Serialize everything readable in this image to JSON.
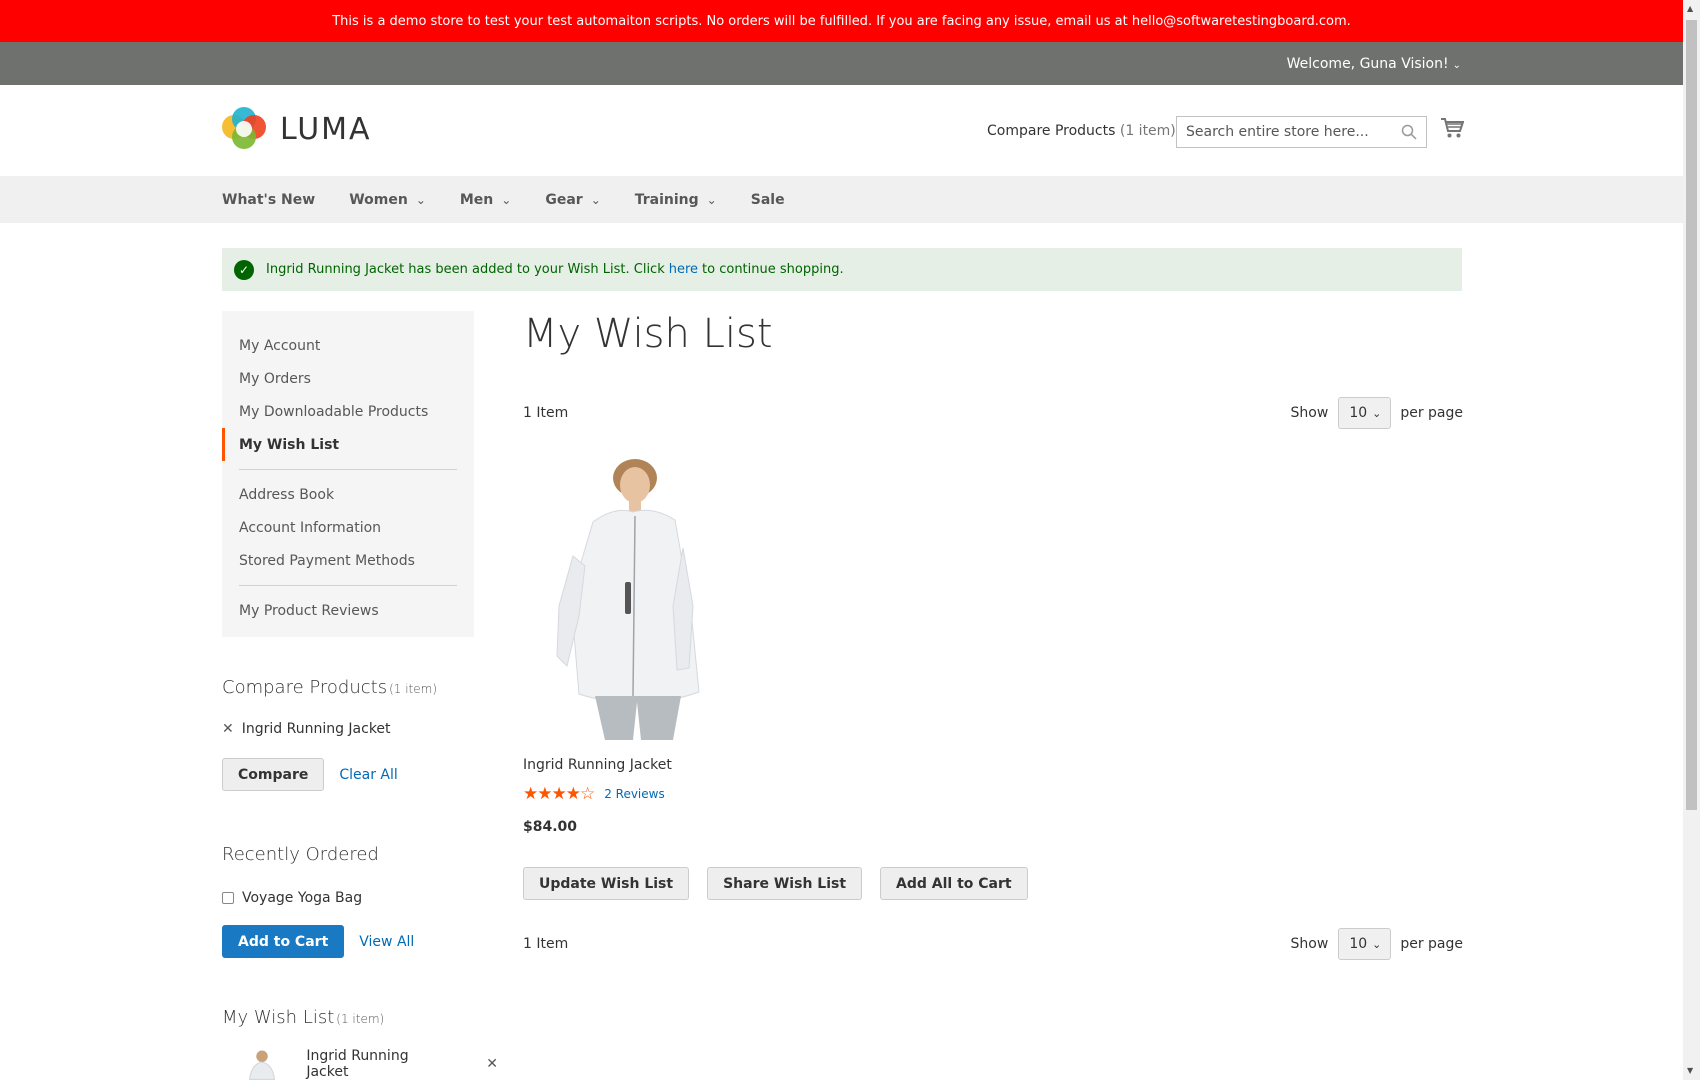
{
  "demo_notice": "This is a demo store to test your test automaiton scripts. No orders will be fulfilled. If you are facing any issue, email us at hello@softwaretestingboard.com.",
  "header": {
    "welcome": "Welcome, Guna Vision!",
    "logo_text": "LUMA",
    "compare_label": "Compare Products",
    "compare_count": "(1 item)",
    "search_placeholder": "Search entire store here...",
    "icons": {
      "search": "search-icon",
      "cart": "cart-icon"
    }
  },
  "nav": {
    "items": [
      {
        "label": "What's New"
      },
      {
        "label": "Women"
      },
      {
        "label": "Men"
      },
      {
        "label": "Gear"
      },
      {
        "label": "Training"
      },
      {
        "label": "Sale"
      }
    ]
  },
  "message": {
    "before": "Ingrid Running Jacket has been added to your Wish List. Click",
    "link": "here",
    "after": "to continue shopping."
  },
  "sidebar": {
    "items": [
      {
        "label": "My Account"
      },
      {
        "label": "My Orders"
      },
      {
        "label": "My Downloadable Products"
      },
      {
        "label": "My Wish List"
      },
      {
        "label": "Address Book"
      },
      {
        "label": "Account Information"
      },
      {
        "label": "Stored Payment Methods"
      },
      {
        "label": "My Product Reviews"
      }
    ]
  },
  "compare_block": {
    "title": "Compare Products",
    "count": "(1 item)",
    "item": "Ingrid Running Jacket",
    "compare_button": "Compare",
    "clear_all": "Clear All"
  },
  "recent_block": {
    "title": "Recently Ordered",
    "item": "Voyage Yoga Bag",
    "add_button": "Add to Cart",
    "view_all": "View All"
  },
  "wishlist_block": {
    "title": "My Wish List",
    "count": "(1 item)",
    "item": "Ingrid Running Jacket"
  },
  "main": {
    "title": "My Wish List",
    "item_count": "1 Item",
    "show_label": "Show",
    "per_page_value": "10",
    "per_page_label": "per page",
    "product": {
      "name": "Ingrid Running Jacket",
      "rating_percent": 90,
      "reviews": "2 Reviews",
      "price": "$84.00"
    },
    "buttons": {
      "update": "Update Wish List",
      "share": "Share Wish List",
      "add_all": "Add All to Cart"
    }
  },
  "colors": {
    "demo_bar": "#ff0000",
    "accent": "#ff5501",
    "link": "#006bb4",
    "primary": "#1979c3"
  }
}
